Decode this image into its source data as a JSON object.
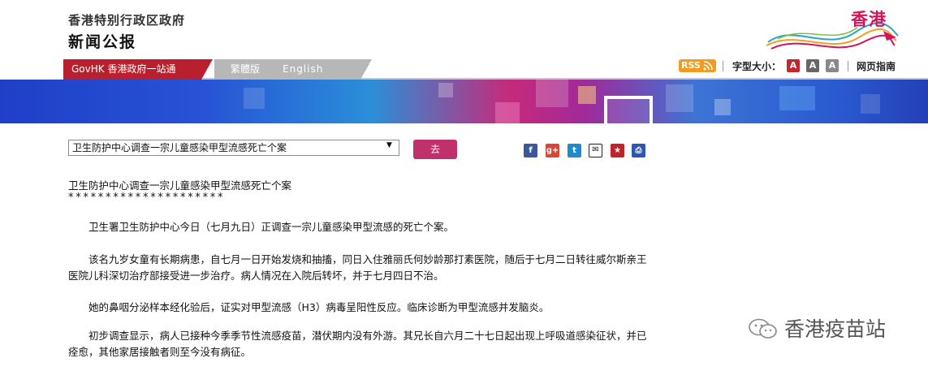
{
  "header": {
    "gov_name": "香港特别行政区政府",
    "press_title": "新闻公报",
    "logo_text": "香港"
  },
  "nav": {
    "govhk": "GovHK 香港政府一站通",
    "traditional": "繁體版",
    "english": "English"
  },
  "tools": {
    "rss": "RSS",
    "font_size_label": "字型大小：",
    "font_size_small": "A",
    "font_size_medium": "A",
    "font_size_large": "A",
    "guide": "网页指南"
  },
  "selector": {
    "selected": "卫生防护中心调查一宗儿童感染甲型流感死亡个案",
    "arrow": "▼",
    "go_label": "去"
  },
  "share": {
    "facebook": "f",
    "google_plus": "g+",
    "twitter": "t",
    "email": "✉",
    "bookmark": "★",
    "print": "⎙"
  },
  "article": {
    "title": "卫生防护中心调查一宗儿童感染甲型流感死亡个案",
    "asterisks": "*********************",
    "paragraphs": [
      "卫生署卫生防护中心今日（七月九日）正调查一宗儿童感染甲型流感的死亡个案。",
      "该名九岁女童有长期病患，自七月一日开始发烧和抽搐，同日入住雅丽氏何妙龄那打素医院，随后于七月二日转往威尔斯亲王医院儿科深切治疗部接受进一步治疗。病人情况在入院后转坏，并于七月四日不治。",
      "她的鼻咽分泌样本经化验后，证实对甲型流感（H3）病毒呈阳性反应。临床诊断为甲型流感并发脑炎。",
      "初步调查显示，病人已接种今季季节性流感疫苗，潜伏期内没有外游。其兄长自六月二十七日起出现上呼吸道感染征状，并已痊愈，其他家居接触者则至今没有病征。"
    ]
  },
  "watermark": "香港疫苗站",
  "colors": {
    "govhk_tab": "#b8202e",
    "go_button": "#c0316b",
    "logo": "#d4145a",
    "rss": "#f29b1f"
  }
}
